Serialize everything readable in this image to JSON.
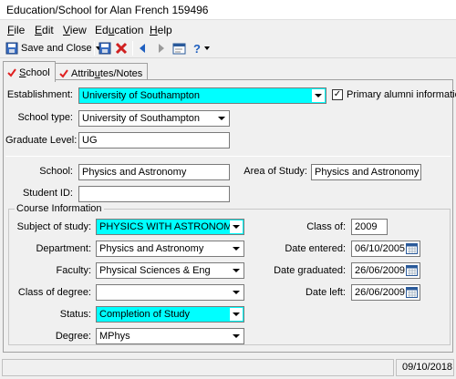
{
  "window": {
    "title": "Education/School for Alan French 159496"
  },
  "menu": {
    "file": {
      "key": "F",
      "rest": "ile"
    },
    "edit": {
      "key": "E",
      "rest": "dit"
    },
    "view": {
      "key": "V",
      "rest": "iew"
    },
    "education": {
      "key": "u",
      "pre": "Ed",
      "rest": "cation"
    },
    "help": {
      "key": "H",
      "rest": "elp"
    }
  },
  "toolbar": {
    "save_close": "Save and Close",
    "help_glyph": "?"
  },
  "tabs": [
    {
      "pre": "",
      "key": "S",
      "rest": "chool"
    },
    {
      "pre": "Attrib",
      "key": "u",
      "rest": "tes/Notes"
    }
  ],
  "form": {
    "establishment_label": "Establishment:",
    "establishment_value": "University of Southampton",
    "primary_alumni_label": "Primary alumni information",
    "primary_alumni_checked": "✓",
    "school_type_label": "School type:",
    "school_type_value": "University of Southampton",
    "graduate_level_label": "Graduate Level:",
    "graduate_level_value": "UG",
    "school_label": "School:",
    "school_value": "Physics and Astronomy",
    "area_label": "Area of Study:",
    "area_value": "Physics and Astronomy",
    "student_id_label": "Student ID:",
    "student_id_value": "",
    "course_info_title": "Course Information",
    "subject_label": "Subject of study:",
    "subject_value": "PHYSICS WITH ASTRONOMY",
    "department_label": "Department:",
    "department_value": "Physics and Astronomy",
    "faculty_label": "Faculty:",
    "faculty_value": "Physical Sciences & Eng",
    "class_degree_label": "Class of degree:",
    "class_degree_value": "",
    "status_label": "Status:",
    "status_value": "Completion of Study",
    "degree_label": "Degree:",
    "degree_value": "MPhys",
    "class_of_label": "Class of:",
    "class_of_value": "2009",
    "date_entered_label": "Date entered:",
    "date_entered_value": "06/10/2005",
    "date_graduated_label": "Date graduated:",
    "date_graduated_value": "26/06/2009",
    "date_left_label": "Date left:",
    "date_left_value": "26/06/2009"
  },
  "status": {
    "date": "09/10/2018"
  },
  "colors": {
    "highlight": "#00ffff",
    "check_red": "#e02020",
    "arrow_blue": "#1f5fbf"
  }
}
